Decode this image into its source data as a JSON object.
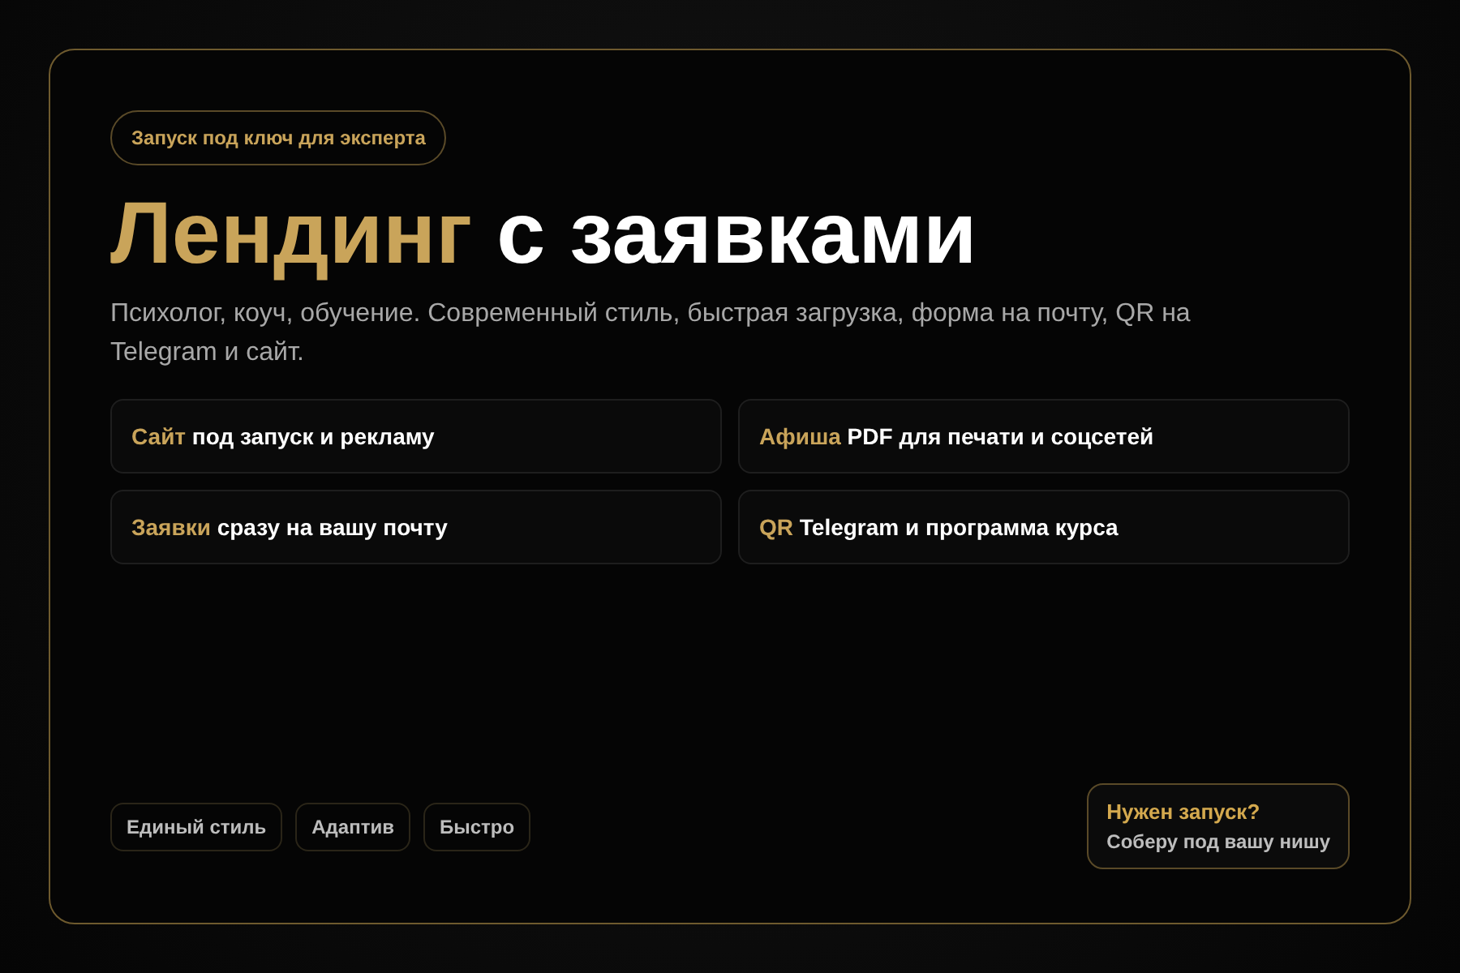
{
  "badge": "Запуск под ключ для эксперта",
  "title": {
    "accent": "Лендинг",
    "rest": "с заявками"
  },
  "subtitle": "Психолог, коуч, обучение. Современный стиль, быстрая загрузка, форма на почту, QR на Telegram и сайт.",
  "features": [
    {
      "accent": "Сайт",
      "text": "под запуск и рекламу"
    },
    {
      "accent": "Афиша",
      "text": "PDF для печати и соцсетей"
    },
    {
      "accent": "Заявки",
      "text": "сразу на вашу почту"
    },
    {
      "accent": "QR",
      "text": "Telegram и программа курса"
    }
  ],
  "tags": [
    "Единый стиль",
    "Адаптив",
    "Быстро"
  ],
  "cta": {
    "title": "Нужен запуск?",
    "text": "Соберу под вашу нишу"
  }
}
